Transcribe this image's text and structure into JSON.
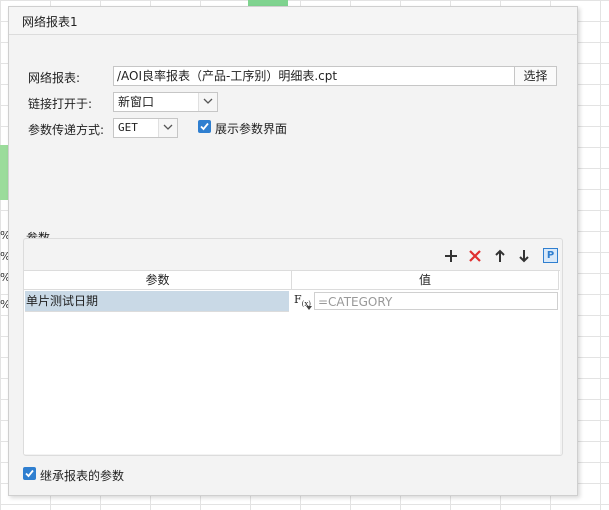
{
  "background": {
    "percent_marks": [
      "%",
      "%",
      "%",
      "%"
    ]
  },
  "dialog": {
    "title": "网络报表1",
    "report_label": "网络报表:",
    "report_path": "/AOI良率报表（产品-工序别）明细表.cpt",
    "choose_button": "选择",
    "link_open_label": "链接打开于:",
    "link_open_value": "新窗口",
    "param_method_label": "参数传递方式:",
    "param_method_value": "GET",
    "show_param_ui_label": "展示参数界面",
    "show_param_ui_checked": true,
    "params_group_title": "参数",
    "table": {
      "headers": [
        "参数",
        "值"
      ],
      "rows": [
        {
          "name": "单片测试日期",
          "formula_button": "F(x)",
          "value_placeholder": "=CATEGORY"
        }
      ]
    },
    "inherit_params_label": "继承报表的参数",
    "inherit_params_checked": true,
    "toolbar_icons": [
      "add-icon",
      "delete-icon",
      "move-up-icon",
      "move-down-icon",
      "parameter-p-icon"
    ],
    "colors": {
      "accent": "#2f7fd0",
      "delete": "#e03030",
      "selected_row": "#c9d9e6"
    }
  }
}
